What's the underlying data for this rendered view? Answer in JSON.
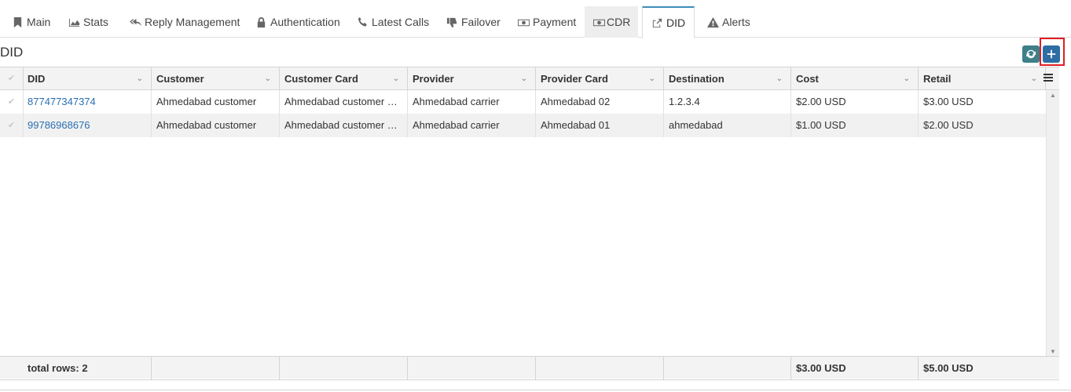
{
  "tabs": [
    {
      "label": "Main",
      "icon": "bookmark-icon"
    },
    {
      "label": "Stats",
      "icon": "area-chart-icon"
    },
    {
      "label": "Reply Management",
      "icon": "reply-all-icon"
    },
    {
      "label": "Authentication",
      "icon": "lock-icon"
    },
    {
      "label": "Latest Calls",
      "icon": "phone-icon"
    },
    {
      "label": "Failover",
      "icon": "thumbs-down-icon"
    },
    {
      "label": "Payment",
      "icon": "money-icon"
    },
    {
      "label": "CDR",
      "icon": "money-icon"
    },
    {
      "label": "DID",
      "icon": "share-square-icon",
      "active": true
    },
    {
      "label": "Alerts",
      "icon": "warning-icon"
    }
  ],
  "page_title": "DID",
  "grid": {
    "columns": [
      "DID",
      "Customer",
      "Customer Card",
      "Provider",
      "Provider Card",
      "Destination",
      "Cost",
      "Retail"
    ],
    "rows": [
      [
        "877477347374",
        "Ahmedabad customer",
        "Ahmedabad customer card",
        "Ahmedabad carrier",
        "Ahmedabad 02",
        "1.2.3.4",
        "$2.00 USD",
        "$3.00 USD"
      ],
      [
        "99786968676",
        "Ahmedabad customer",
        "Ahmedabad customer card",
        "Ahmedabad carrier",
        "Ahmedabad 01",
        "ahmedabad",
        "$1.00 USD",
        "$2.00 USD"
      ]
    ],
    "footer": {
      "total_rows": "total rows: 2",
      "cost_total": "$3.00 USD",
      "retail_total": "$5.00 USD"
    }
  },
  "colors": {
    "accent": "#3c8dbc",
    "add_button": "#2e6da4",
    "refresh_button": "#3f7f88",
    "highlight": "#e21d27",
    "link": "#2a6fb0"
  }
}
